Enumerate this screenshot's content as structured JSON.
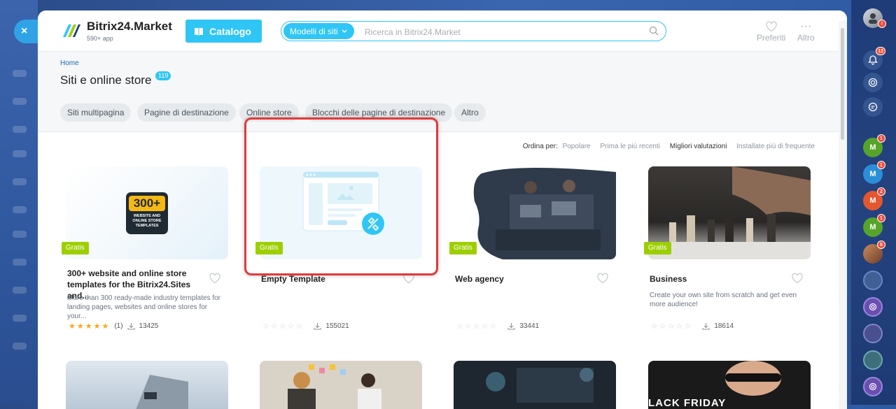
{
  "app": {
    "logo_title": "Bitrix24.Market",
    "logo_sub": "590+ app",
    "catalog_label": "Catalogo",
    "close_label": "×"
  },
  "search": {
    "scope": "Modelli di siti",
    "placeholder": "Ricerca in Bitrix24.Market"
  },
  "toolbar": {
    "favorites": "Preferiti",
    "more": "Altro"
  },
  "page": {
    "breadcrumb": "Home",
    "title": "Siti e online store",
    "count": "119"
  },
  "filters": [
    "Siti multipagina",
    "Pagine di destinazione",
    "Online store",
    "Blocchi delle pagine di destinazione",
    "Altro"
  ],
  "sort": {
    "label": "Ordina per:",
    "options": [
      "Popolare",
      "Prima le più recenti",
      "Migliori valutazioni",
      "Installate più di frequente"
    ]
  },
  "cards": [
    {
      "tag": "Gratis",
      "title": "300+ website and online store templates for the Bitrix24.Sites and...",
      "desc": "More than 300 ready-made industry templates for landing pages, websites and online stores for your...",
      "rating_text": "(1)",
      "installs": "13425",
      "badge_big": "300+",
      "badge_small": "WEBSITE AND ONLINE STORE TEMPLATES"
    },
    {
      "tag": "Gratis",
      "title": "Empty Template",
      "desc": "",
      "rating_text": "",
      "installs": "155021"
    },
    {
      "tag": "Gratis",
      "title": "Web agency",
      "desc": "",
      "rating_text": "",
      "installs": "33441"
    },
    {
      "tag": "Gratis",
      "title": "Business",
      "desc": "Create your own site from scratch and get even more audience!",
      "rating_text": "",
      "installs": "18614"
    }
  ],
  "row2_banner": "LACK FRIDAY",
  "right_bar": {
    "badges": [
      "12",
      "1",
      "1",
      "2",
      "1",
      "6"
    ],
    "avatar_letter": "M"
  },
  "colors": {
    "accent": "#2fc6f6",
    "tag": "#9dcf00",
    "highlight": "#e2393b"
  }
}
